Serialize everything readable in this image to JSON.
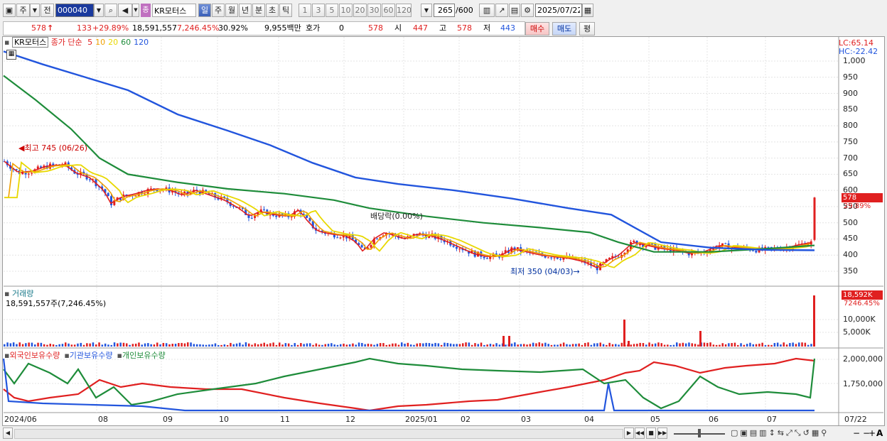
{
  "toolbar": {
    "period_left": "주",
    "prev_label": "전",
    "stock_code": "000040",
    "stock_name": "KR모터스",
    "badge": "종",
    "periods": [
      "일",
      "주",
      "월",
      "년",
      "분",
      "초",
      "틱"
    ],
    "minutes": [
      "1",
      "3",
      "5",
      "10",
      "20",
      "30",
      "60",
      "120"
    ],
    "count": "265",
    "count_total": "/600",
    "date": "2025/07/22",
    "icons": [
      "window-icon",
      "dropdown-icon",
      "search-icon",
      "speaker-icon",
      "candle-type-icon",
      "chart-tool-icon",
      "save-icon",
      "settings-icon",
      "calendar-icon"
    ]
  },
  "quote": {
    "price": "578",
    "arrow": "↑",
    "change": "133",
    "change_pct": "+29.89%",
    "volume": "18,591,557",
    "volume_pct": "7,246.45%",
    "turnover": "30.92%",
    "amount": "9,955백만",
    "hoga_label": "호가",
    "hoga_value": "0",
    "ask_price": "578",
    "open_label": "시",
    "open": "447",
    "high_label": "고",
    "high": "578",
    "low_label": "저",
    "low": "443",
    "buy_label": "매수",
    "sell_label": "매도",
    "avg_label": "평"
  },
  "price_panel": {
    "title": "KR모터스",
    "legend_label": "종가 단순",
    "ma": [
      {
        "label": "5",
        "color": "#e02020"
      },
      {
        "label": "10",
        "color": "#f0a000"
      },
      {
        "label": "20",
        "color": "#e8d800"
      },
      {
        "label": "60",
        "color": "#1e8c3a"
      },
      {
        "label": "120",
        "color": "#2255dd"
      }
    ],
    "lc": "LC:65.14",
    "hc": "HC:-22.42",
    "y_ticks": [
      "1,000",
      "950",
      "900",
      "850",
      "800",
      "750",
      "700",
      "650",
      "600",
      "550",
      "500",
      "450",
      "400",
      "350"
    ],
    "current_label": "578",
    "current_pct": "29.89%",
    "high_annotation": "최고 745 (06/26)",
    "low_annotation": "최저 350 (04/03)",
    "dividend_annotation": "배당락(0.00%)"
  },
  "volume_panel": {
    "title": "거래량",
    "value": "18,591,557주(7,246.45%)",
    "badge_value": "18,592K",
    "badge_pct": "7246.45%",
    "y_ticks": [
      "10,000K",
      "5,000K"
    ]
  },
  "holdings_panel": {
    "legend": [
      {
        "label": "외국인보유수량",
        "color": "#e02020"
      },
      {
        "label": "기관보유수량",
        "color": "#2255dd"
      },
      {
        "label": "개인보유수량",
        "color": "#1e8c3a"
      }
    ],
    "y_ticks": [
      "2,000,000",
      "1,750,000"
    ]
  },
  "x_axis": [
    "2024/06",
    "08",
    "09",
    "10",
    "11",
    "12",
    "2025/01",
    "02",
    "03",
    "04",
    "05",
    "06",
    "07"
  ],
  "x_axis_end": "07/22",
  "colors": {
    "up": "#e02020",
    "down": "#2255dd",
    "ma60": "#1e8c3a",
    "ma120": "#2255dd"
  }
}
